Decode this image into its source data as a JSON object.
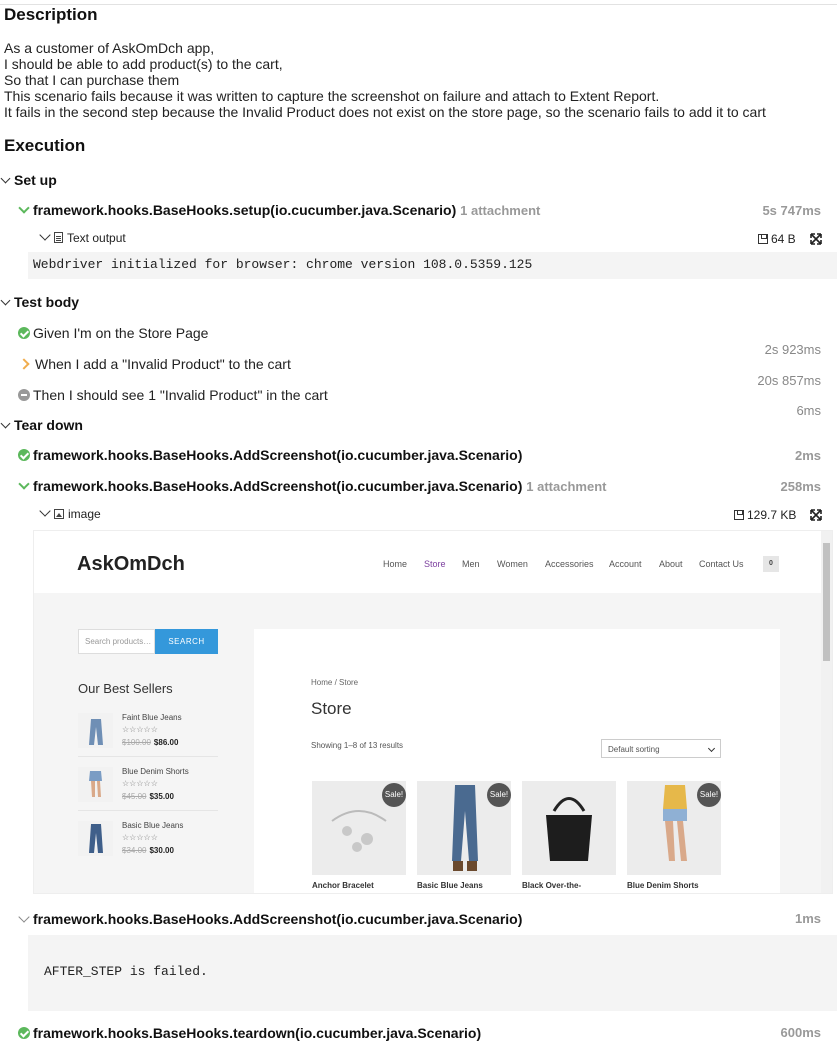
{
  "description": {
    "heading": "Description",
    "lines": [
      "As a customer of AskOmDch app,",
      "I should be able to add product(s) to the cart,",
      "So that I can purchase them",
      "This scenario fails because it was written to capture the screenshot on failure and attach to Extent Report.",
      "It fails in the second step because the Invalid Product does not exist on the store page, so the scenario fails to add it to cart"
    ]
  },
  "execution": {
    "heading": "Execution",
    "setup": {
      "label": "Set up",
      "hook": "framework.hooks.BaseHooks.setup(io.cucumber.java.Scenario)",
      "attachments": "1 attachment",
      "duration": "5s 747ms",
      "output_label": "Text output",
      "output_size": "64 B",
      "output_text": "Webdriver initialized for browser: chrome version 108.0.5359.125"
    },
    "test_body": {
      "label": "Test body",
      "steps": [
        {
          "keyword": "Given",
          "text": "I'm on the Store Page",
          "status": "passed",
          "duration": "2s 923ms"
        },
        {
          "keyword": "When",
          "text": "I add a \"Invalid Product\" to the cart",
          "status": "failed",
          "duration": "20s 857ms"
        },
        {
          "keyword": "Then",
          "text": "I should see 1 \"Invalid Product\" in the cart",
          "status": "skipped",
          "duration": "6ms"
        }
      ]
    },
    "teardown": {
      "label": "Tear down",
      "hook1": "framework.hooks.BaseHooks.AddScreenshot(io.cucumber.java.Scenario)",
      "hook1_duration": "2ms",
      "hook2": "framework.hooks.BaseHooks.AddScreenshot(io.cucumber.java.Scenario)",
      "hook2_attachments": "1 attachment",
      "hook2_duration": "258ms",
      "image_label": "image",
      "image_size": "129.7 KB",
      "hook3": "framework.hooks.BaseHooks.AddScreenshot(io.cucumber.java.Scenario)",
      "hook3_duration": "1ms",
      "hook3_error": "AFTER_STEP is failed.",
      "hook4": "framework.hooks.BaseHooks.teardown(io.cucumber.java.Scenario)",
      "hook4_duration": "600ms"
    }
  },
  "screenshot": {
    "brand": "AskOmDch",
    "nav": [
      "Home",
      "Store",
      "Men",
      "Women",
      "Accessories",
      "Account",
      "About",
      "Contact Us"
    ],
    "cart_count": "0",
    "search_placeholder": "Search products…",
    "search_button": "SEARCH",
    "best_sellers_title": "Our Best Sellers",
    "best_sellers": [
      {
        "name": "Faint Blue Jeans",
        "stars": "☆☆☆☆☆",
        "old_price": "$100.00",
        "new_price": "$86.00"
      },
      {
        "name": "Blue Denim Shorts",
        "stars": "☆☆☆☆☆",
        "old_price": "$45.00",
        "new_price": "$35.00"
      },
      {
        "name": "Basic Blue Jeans",
        "stars": "☆☆☆☆☆",
        "old_price": "$34.00",
        "new_price": "$30.00"
      }
    ],
    "breadcrumb": "Home / Store",
    "page_title": "Store",
    "showing": "Showing 1–8 of 13 results",
    "sorting": "Default sorting",
    "sale_badge": "Sale!",
    "products": [
      {
        "name": "Anchor Bracelet",
        "sale": true
      },
      {
        "name": "Basic Blue Jeans",
        "sale": true
      },
      {
        "name": "Black Over-the-",
        "sale": false
      },
      {
        "name": "Blue Denim Shorts",
        "sale": true
      }
    ]
  },
  "colors": {
    "passed": "#5cb85c",
    "failed": "#f0ad4e",
    "skipped": "#999999",
    "search_button": "#3498db"
  }
}
